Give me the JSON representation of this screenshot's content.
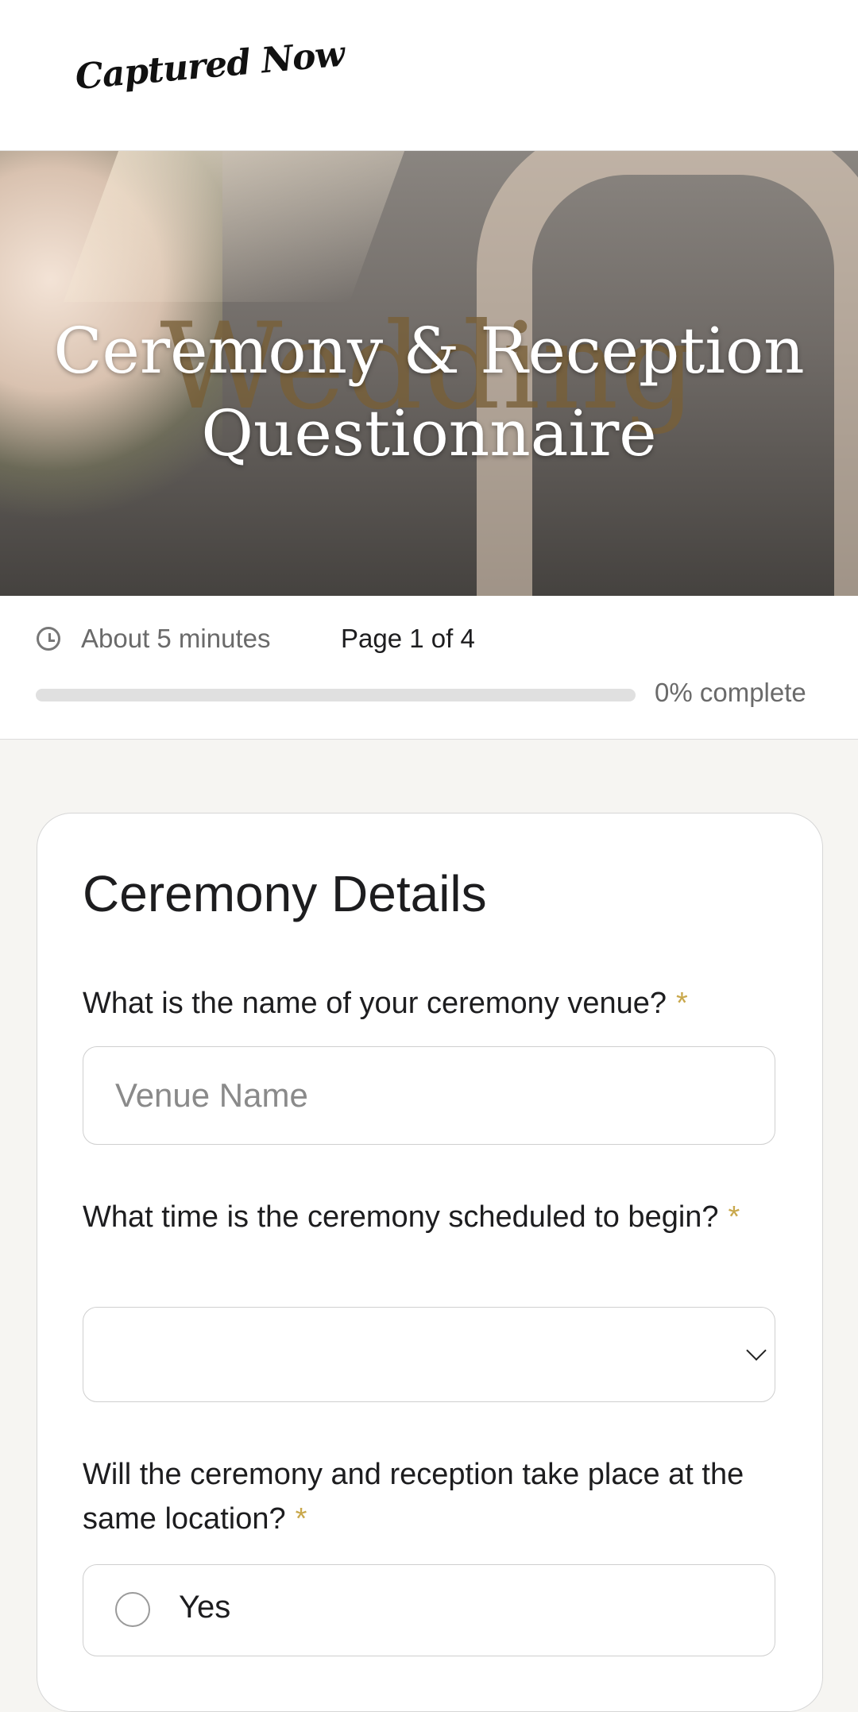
{
  "header": {
    "logo_text": "Captured Now"
  },
  "hero": {
    "background_word": "Wedding",
    "title": "Ceremony & Reception Questionnaire"
  },
  "progress": {
    "time_estimate": "About 5 minutes",
    "page_indicator": "Page 1 of 4",
    "percent_complete": 0,
    "percent_label": "0% complete"
  },
  "form": {
    "section_title": "Ceremony Details",
    "required_marker": "*",
    "questions": [
      {
        "label": "What is the name of your ceremony venue?",
        "type": "text",
        "placeholder": "Venue Name",
        "value": ""
      },
      {
        "label": "What time is the ceremony scheduled to begin?",
        "type": "select",
        "selected": ""
      },
      {
        "label": "Will the ceremony and reception take place at the same location?",
        "type": "radio",
        "options": [
          {
            "label": "Yes",
            "checked": false
          }
        ]
      }
    ]
  },
  "colors": {
    "accent": "#c9a84c",
    "page_bg": "#f6f5f2"
  },
  "icons": {
    "clock": "clock-icon",
    "dropdown": "chevron-down-icon",
    "radio": "radio-unchecked-icon"
  }
}
